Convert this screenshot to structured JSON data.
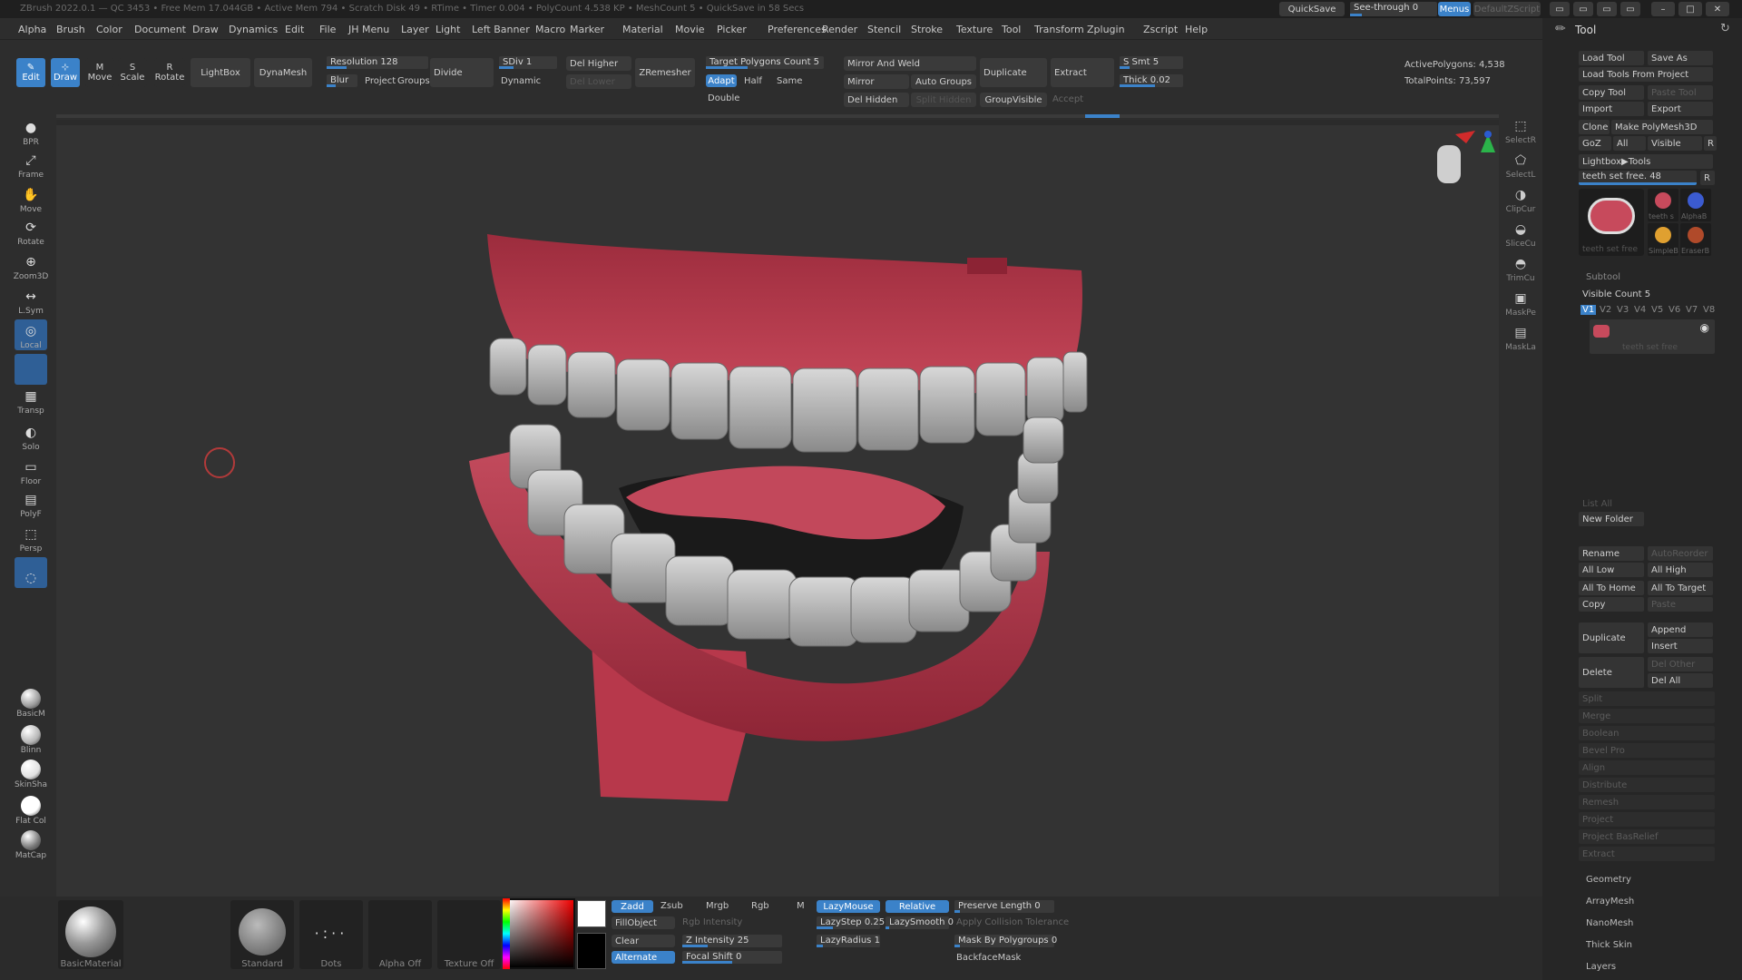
{
  "title_bar": {
    "text": "ZBrush 2022.0.1 — QC 3453 • Free Mem 17.044GB • Active Mem 794 • Scratch Disk 49 • RTime • Timer 0.004 • PolyCount 4.538 KP • MeshCount 5 • QuickSave in 58 Secs"
  },
  "top_right": {
    "quicksave": "QuickSave",
    "seethrough": "See-through 0",
    "menus": "Menus",
    "default_script": "DefaultZScript"
  },
  "menubar": [
    "Alpha",
    "Brush",
    "Color",
    "Document",
    "Draw",
    "Dynamics",
    "Edit",
    "File",
    "JH Menu",
    "Layer",
    "Light",
    "Left Banner",
    "Macro",
    "Marker",
    "Material",
    "Movie",
    "Picker",
    "Preferences",
    "Render",
    "Stencil",
    "Stroke",
    "Texture",
    "Tool",
    "Transform",
    "Zplugin",
    "Zscript",
    "Help"
  ],
  "shelf": {
    "edit": "Edit",
    "draw": "Draw",
    "move": "Move",
    "scale": "Scale",
    "rotate": "Rotate",
    "lightbox": "LightBox",
    "dynamesh": "DynaMesh",
    "resolution": "Resolution 128",
    "blur": "Blur",
    "project": "Project",
    "groups": "Groups",
    "divide": "Divide",
    "sdiv": "SDiv 1",
    "dynamic": "Dynamic",
    "del_higher": "Del Higher",
    "del_lower": "Del Lower",
    "target_polygons": "Target Polygons Count 5",
    "adapt": "Adapt",
    "half": "Half",
    "same": "Same",
    "double": "Double",
    "zremesher": "ZRemesher",
    "mirror_weld": "Mirror And Weld",
    "mirror": "Mirror",
    "auto_groups": "Auto Groups",
    "del_hidden": "Del Hidden",
    "split_hidden": "Split Hidden",
    "duplicate": "Duplicate",
    "group_visible": "GroupVisible",
    "extract": "Extract",
    "accept": "Accept",
    "s_smt": "S Smt 5",
    "thick": "Thick 0.02",
    "active_polygons": "ActivePolygons: 4,538",
    "total_points": "TotalPoints: 73,597"
  },
  "left_tools": [
    {
      "label": "BPR",
      "icon": "bpr-icon"
    },
    {
      "label": "Frame",
      "icon": "frame-icon"
    },
    {
      "label": "Move",
      "icon": "move-hand-icon"
    },
    {
      "label": "Rotate",
      "icon": "rotate-icon"
    },
    {
      "label": "Zoom3D",
      "icon": "zoom-icon"
    },
    {
      "label": "L.Sym",
      "icon": "lsym-icon"
    },
    {
      "label": "Local",
      "icon": "local-icon"
    },
    {
      "label": "",
      "icon": "blank-icon"
    },
    {
      "label": "Transp",
      "icon": "transp-icon"
    },
    {
      "label": "Solo",
      "icon": "solo-icon"
    },
    {
      "label": "Floor",
      "icon": "floor-icon"
    },
    {
      "label": "PolyF",
      "icon": "polyf-icon"
    },
    {
      "label": "Persp",
      "icon": "persp-icon"
    },
    {
      "label": "",
      "icon": "dynamic-icon"
    }
  ],
  "left_materials": [
    "BasicM",
    "Blinn",
    "SkinSha",
    "Flat Col",
    "MatCap"
  ],
  "right_tools": [
    "SelectR",
    "SelectL",
    "ClipCur",
    "SliceCu",
    "TrimCu",
    "MaskPe",
    "MaskLa"
  ],
  "tool_panel": {
    "title": "Tool",
    "load_tool": "Load Tool",
    "save_as": "Save As",
    "load_from_project": "Load Tools From Project",
    "copy_tool": "Copy Tool",
    "paste_tool": "Paste Tool",
    "import": "Import",
    "export": "Export",
    "clone": "Clone",
    "make_polymesh": "Make PolyMesh3D",
    "goz": "GoZ",
    "all": "All",
    "visible": "Visible",
    "r": "R",
    "lightbox_tools": "Lightbox▶Tools",
    "tool_name_slider": "teeth set free. 48",
    "thumbs": [
      "teeth set free",
      "teeth s",
      "AlphaB",
      "SimpleB",
      "EraserB"
    ],
    "subtool_header": "Subtool",
    "visible_count": "Visible Count 5",
    "versions": [
      "V1",
      "V2",
      "V3",
      "V4",
      "V5",
      "V6",
      "V7",
      "V8"
    ],
    "subtool_item": "teeth set free",
    "list_all": "List All",
    "new_folder": "New Folder",
    "rename": "Rename",
    "autoreorder": "AutoReorder",
    "all_low": "All Low",
    "all_high": "All High",
    "all_to_home": "All To Home",
    "all_to_target": "All To Target",
    "copy": "Copy",
    "paste": "Paste",
    "duplicate": "Duplicate",
    "append": "Append",
    "insert": "Insert",
    "delete": "Delete",
    "del_other": "Del Other",
    "del_all": "Del All",
    "subitems": [
      "Split",
      "Merge",
      "Boolean",
      "Bevel Pro",
      "Align",
      "Distribute",
      "Remesh",
      "Project",
      "Project BasRelief",
      "Extract"
    ],
    "sections": [
      "Geometry",
      "ArrayMesh",
      "NanoMesh",
      "Thick Skin",
      "Layers"
    ]
  },
  "bottom": {
    "material": "BasicMaterial",
    "brush": "Standard",
    "stroke": "Dots",
    "alpha": "Alpha Off",
    "texture": "Texture Off",
    "zadd": "Zadd",
    "zsub": "Zsub",
    "mrgb": "Mrgb",
    "rgb": "Rgb",
    "m": "M",
    "fill_object": "FillObject",
    "clear": "Clear",
    "alternate": "Alternate",
    "rgb_intensity": "Rgb Intensity",
    "z_intensity": "Z Intensity 25",
    "focal_shift": "Focal Shift 0",
    "lazymouse": "LazyMouse",
    "relative": "Relative",
    "lazystep": "LazyStep 0.25",
    "lazysmooth": "LazySmooth 0",
    "lazyradius": "LazyRadius 1",
    "preserve_length": "Preserve Length 0",
    "apply_tolerance": "Apply Collision Tolerance",
    "mask_by_polygroups": "Mask By Polygroups 0",
    "backface_mask": "BackfaceMask"
  },
  "colors": {
    "accent": "#3b82c9",
    "gum": "#b23a4c",
    "teeth": "#bdbdbd",
    "panel": "#262626",
    "viewport": "#333333"
  }
}
